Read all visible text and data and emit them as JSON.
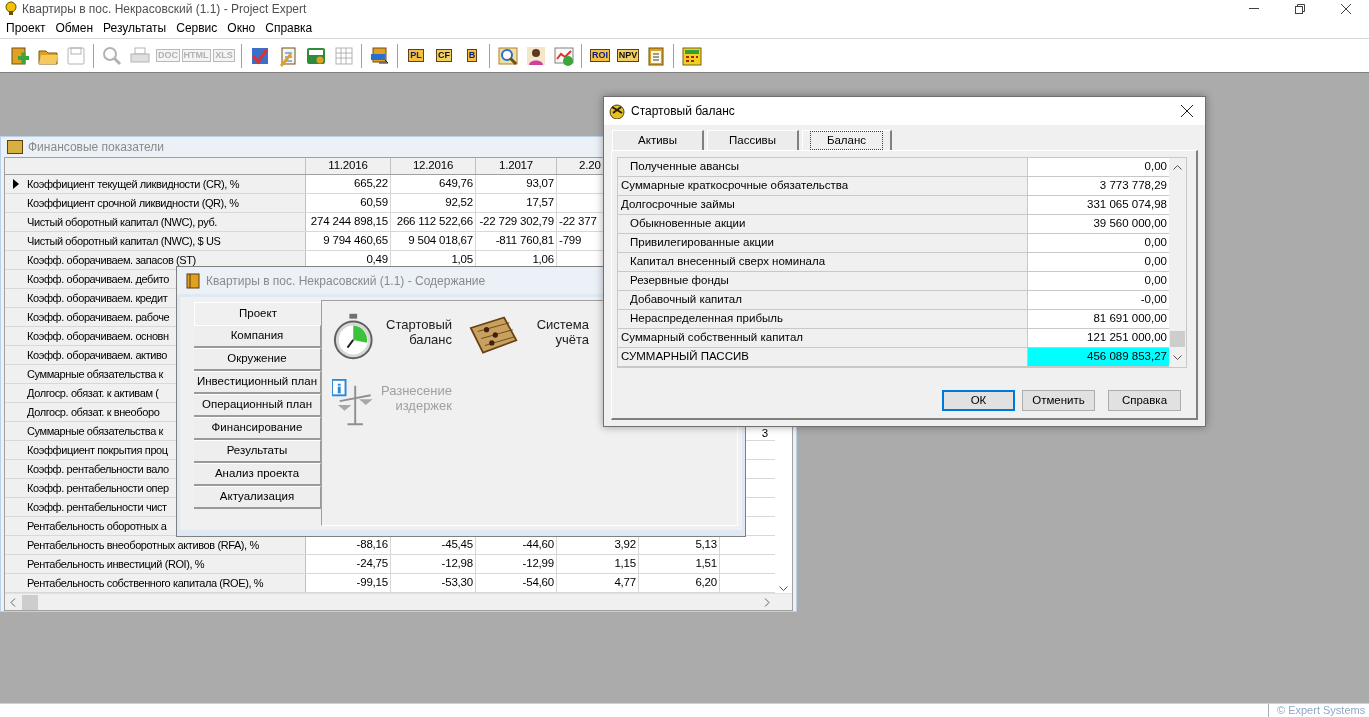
{
  "window": {
    "title": "Квартиры в пос. Некрасовский (1.1) - Project Expert"
  },
  "menu": [
    "Проект",
    "Обмен",
    "Результаты",
    "Сервис",
    "Окно",
    "Справка"
  ],
  "toolbar": [
    [
      {
        "disabled": false
      },
      {
        "disabled": false
      },
      {
        "disabled": true
      }
    ],
    [
      {
        "disabled": true
      },
      {
        "disabled": true
      },
      {
        "label": "DOC",
        "disabled": true
      },
      {
        "label": "HTML",
        "disabled": true
      },
      {
        "label": "XLS",
        "disabled": true
      }
    ],
    [
      {
        "disabled": false
      },
      {
        "disabled": false
      },
      {
        "disabled": false
      },
      {
        "disabled": true
      }
    ],
    [
      {
        "disabled": false
      }
    ],
    [
      {
        "label": "PL",
        "disabled": false
      },
      {
        "label": "CF",
        "disabled": false
      },
      {
        "label": "B",
        "disabled": false
      }
    ],
    [
      {
        "disabled": false
      },
      {
        "disabled": false
      },
      {
        "disabled": false
      }
    ],
    [
      {
        "label": "ROI",
        "disabled": false
      },
      {
        "label": "NPV",
        "disabled": false
      },
      {
        "disabled": false
      }
    ],
    [
      {
        "disabled": false
      }
    ]
  ],
  "financial_window": {
    "title": "Финансовые показатели",
    "columns": [
      "11.2016",
      "12.2016",
      "1.2017",
      "2.20"
    ],
    "rows": [
      {
        "label": "Коэффициент текущей ликвидности (CR), %",
        "current": true,
        "values": [
          "665,22",
          "649,76",
          "93,07"
        ]
      },
      {
        "label": "Коэффициент срочной ликвидности (QR), %",
        "current": false,
        "values": [
          "60,59",
          "92,52",
          "17,57"
        ]
      },
      {
        "label": "Чистый оборотный капитал (NWC), руб.",
        "current": false,
        "values": [
          "274 244 898,15",
          "266 112 522,66",
          "-22 729 302,79",
          "-22 377"
        ]
      },
      {
        "label": "Чистый оборотный капитал (NWC), $ US",
        "current": false,
        "values": [
          "9 794 460,65",
          "9 504 018,67",
          "-811 760,81",
          "-799"
        ]
      },
      {
        "label": "Коэфф. оборачиваем. запасов (ST)",
        "current": false,
        "values": [
          "0,49",
          "1,05",
          "1,06"
        ]
      },
      {
        "label": "Коэфф. оборачиваем. дебито",
        "current": false,
        "values": []
      },
      {
        "label": "Коэфф. оборачиваем. кредит",
        "current": false,
        "values": []
      },
      {
        "label": "Коэфф. оборачиваем. рабоче",
        "current": false,
        "values": []
      },
      {
        "label": "Коэфф. оборачиваем. основн",
        "current": false,
        "values": []
      },
      {
        "label": "Коэфф. оборачиваем. активо",
        "current": false,
        "values": []
      },
      {
        "label": "Суммарные обязательства к",
        "current": false,
        "values": []
      },
      {
        "label": "Долгоср. обязат. к активам (",
        "current": false,
        "values": []
      },
      {
        "label": "Долгоср. обязат. к внеоборо",
        "current": false,
        "values": []
      },
      {
        "label": "Суммарные обязательства к",
        "current": false,
        "values": [],
        "column_6": "3"
      },
      {
        "label": "Коэффициент покрытия проц",
        "current": false,
        "values": []
      },
      {
        "label": "Коэфф. рентабельности вало",
        "current": false,
        "values": []
      },
      {
        "label": "Коэфф. рентабельности опер",
        "current": false,
        "values": []
      },
      {
        "label": "Коэфф. рентабельности чист",
        "current": false,
        "values": []
      },
      {
        "label": "Рентабельность оборотных а",
        "current": false,
        "values": []
      },
      {
        "label": "Рентабельность внеоборотных активов (RFA), %",
        "current": false,
        "values": [
          "-88,16",
          "-45,45",
          "-44,60",
          "3,92",
          "5,13"
        ]
      },
      {
        "label": "Рентабельность инвестиций (ROI), %",
        "current": false,
        "values": [
          "-24,75",
          "-12,98",
          "-12,99",
          "1,15",
          "1,51"
        ]
      },
      {
        "label": "Рентабельность собственного капитала (ROE), %",
        "current": false,
        "values": [
          "-99,15",
          "-53,30",
          "-54,60",
          "4,77",
          "6,20"
        ]
      }
    ]
  },
  "contents_window": {
    "title": "Квартиры в пос. Некрасовский (1.1) - Содержание",
    "nav": [
      {
        "label": "Проект",
        "selected": true
      },
      {
        "label": "Компания",
        "selected": false
      },
      {
        "label": "Окружение",
        "selected": false
      },
      {
        "label": "Инвестиционный план",
        "selected": false
      },
      {
        "label": "Операционный план",
        "selected": false
      },
      {
        "label": "Финансирование",
        "selected": false
      },
      {
        "label": "Результаты",
        "selected": false
      },
      {
        "label": "Анализ проекта",
        "selected": false
      },
      {
        "label": "Актуализация",
        "selected": false
      }
    ],
    "items": [
      {
        "label": "Стартовый баланс",
        "kind": "stopwatch",
        "disabled": false
      },
      {
        "label": "Система учёта",
        "kind": "abacus",
        "disabled": false
      },
      {
        "label": "Разнесение издержек",
        "kind": "scales",
        "disabled": true
      }
    ]
  },
  "dialog": {
    "title": "Стартовый баланс",
    "tabs": [
      {
        "label": "Активы",
        "selected": false
      },
      {
        "label": "Пассивы",
        "selected": false
      },
      {
        "label": "Баланс",
        "selected": true
      }
    ],
    "rows": [
      {
        "label": "Полученные авансы",
        "kind": "item",
        "value": "0,00",
        "selected": false
      },
      {
        "label": "Суммарные краткосрочные обязательства",
        "kind": "total",
        "value": "3 773 778,29",
        "selected": false
      },
      {
        "label": "Долгосрочные займы",
        "kind": "total",
        "value": "331 065 074,98",
        "selected": false
      },
      {
        "label": "Обыкновенные акции",
        "kind": "item",
        "value": "39 560 000,00",
        "selected": false
      },
      {
        "label": "Привилегированные акции",
        "kind": "item",
        "value": "0,00",
        "selected": false
      },
      {
        "label": "Капитал внесенный сверх номинала",
        "kind": "item",
        "value": "0,00",
        "selected": false
      },
      {
        "label": "Резервные фонды",
        "kind": "item",
        "value": "0,00",
        "selected": false
      },
      {
        "label": "Добавочный капитал",
        "kind": "item",
        "value": "-0,00",
        "selected": false
      },
      {
        "label": "Нераспределенная прибыль",
        "kind": "item",
        "value": "81 691 000,00",
        "selected": false
      },
      {
        "label": "Суммарный собственный капитал",
        "kind": "total",
        "value": "121 251 000,00",
        "selected": false
      },
      {
        "label": "СУММАРНЫЙ ПАССИВ",
        "kind": "total",
        "value": "456 089 853,27",
        "selected": true
      }
    ],
    "buttons": [
      {
        "label": "ОК",
        "default": true
      },
      {
        "label": "Отменить",
        "default": false
      },
      {
        "label": "Справка",
        "default": false
      }
    ]
  },
  "status_bar": {
    "copyright": "© Expert Systems"
  }
}
